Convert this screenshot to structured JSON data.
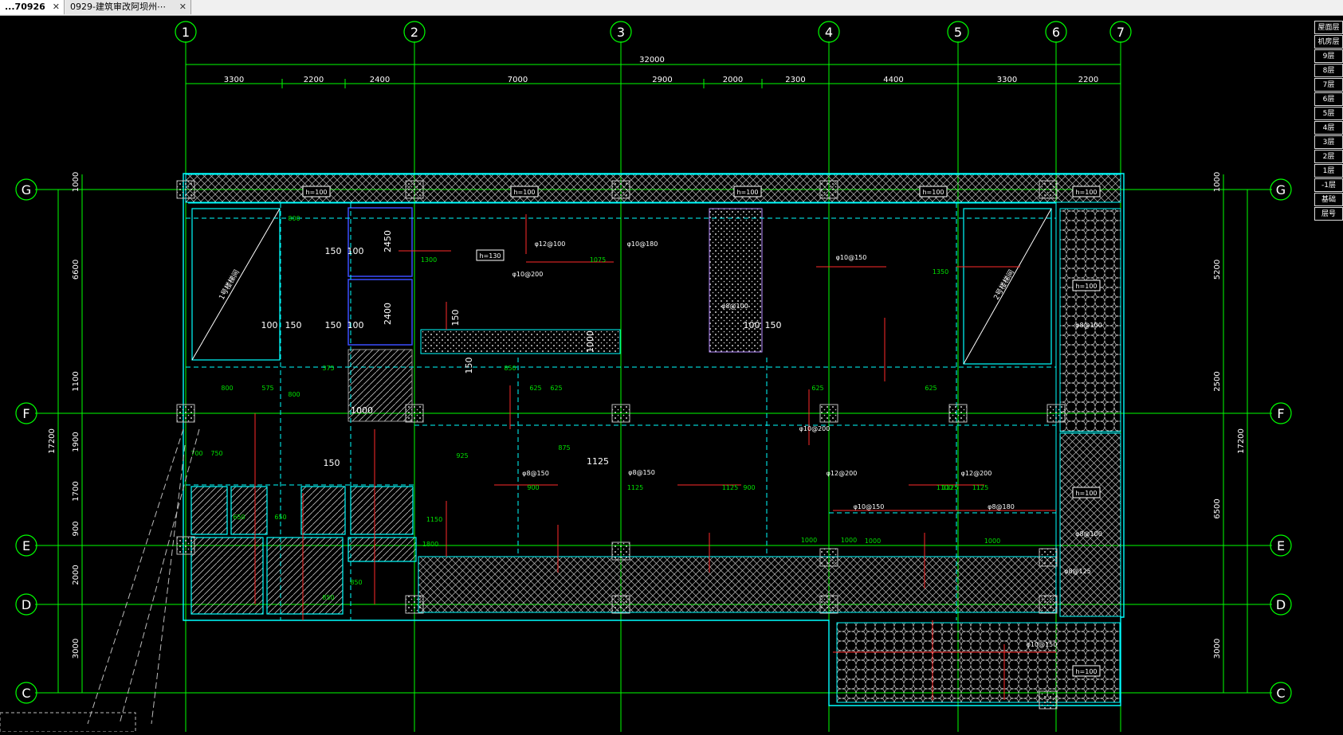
{
  "tabs": [
    {
      "label": "...70926",
      "close": "✕",
      "active": true
    },
    {
      "label": "0929-建筑审改阿坝州⋯",
      "close": "✕",
      "active": false
    }
  ],
  "drawing": {
    "colors": {
      "background": "#000000",
      "axis": "#00ff00",
      "dim": "#00ff00",
      "wall": "#00ffff",
      "rebar": "#ff2a2a",
      "slab_note": "#00e000",
      "column": "#d8d8d8"
    },
    "grid_columns": [
      "1",
      "2",
      "3",
      "4",
      "5",
      "6",
      "7"
    ],
    "grid_rows": [
      "G",
      "F",
      "E",
      "D",
      "C"
    ],
    "overall_top_dimension": "32000",
    "top_dimensions": [
      "3300",
      "2200",
      "2400",
      "7000",
      "2900",
      "2000",
      "2300",
      "4400",
      "3300",
      "2200"
    ],
    "left_dimensions": [
      "1000",
      "6600",
      "1100",
      "1900",
      "1700",
      "900",
      "2000",
      "3000"
    ],
    "left_total": "17200",
    "right_dimensions": [
      "1000",
      "5200",
      "2500",
      "6500",
      "3000"
    ],
    "right_total": "17200",
    "slab_thickness_labels": [
      "h=100",
      "h=100",
      "h=100",
      "h=100",
      "h=100",
      "h=130",
      "h=100",
      "h=100",
      "h=100"
    ],
    "rebar_labels": [
      "φ10@200",
      "φ12@100",
      "φ10@180",
      "φ10@150",
      "φ8@150",
      "φ10@200",
      "φ12@200",
      "φ12@200",
      "φ8@180",
      "φ10@150",
      "φ8@100",
      "φ8@100",
      "φ8@125",
      "φ10@150",
      "φ8@100",
      "φ8@150"
    ],
    "rebar_lengths": [
      "800",
      "800",
      "800",
      "1300",
      "1075",
      "1350",
      "375",
      "575",
      "850",
      "625",
      "625",
      "625",
      "625",
      "925",
      "875",
      "1125",
      "1125",
      "900",
      "900",
      "1125",
      "1125",
      "1100",
      "650",
      "650",
      "850",
      "850",
      "1000",
      "1000",
      "700",
      "750",
      "1150",
      "1800",
      "1000",
      "1000"
    ],
    "opening_labels": [
      "2450",
      "2400",
      "150",
      "100",
      "150",
      "100",
      "100",
      "150",
      "150",
      "1000",
      "100",
      "150",
      "1125",
      "1000",
      "150",
      "150"
    ],
    "stair_labels": [
      "1号楼梯间",
      "2号楼梯间"
    ],
    "legend_rows": [
      "屋面层",
      "机房层",
      "9层",
      "8层",
      "7层",
      "6层",
      "5层",
      "4层",
      "3层",
      "2层",
      "1层",
      "-1层",
      "基础",
      "层号"
    ]
  }
}
